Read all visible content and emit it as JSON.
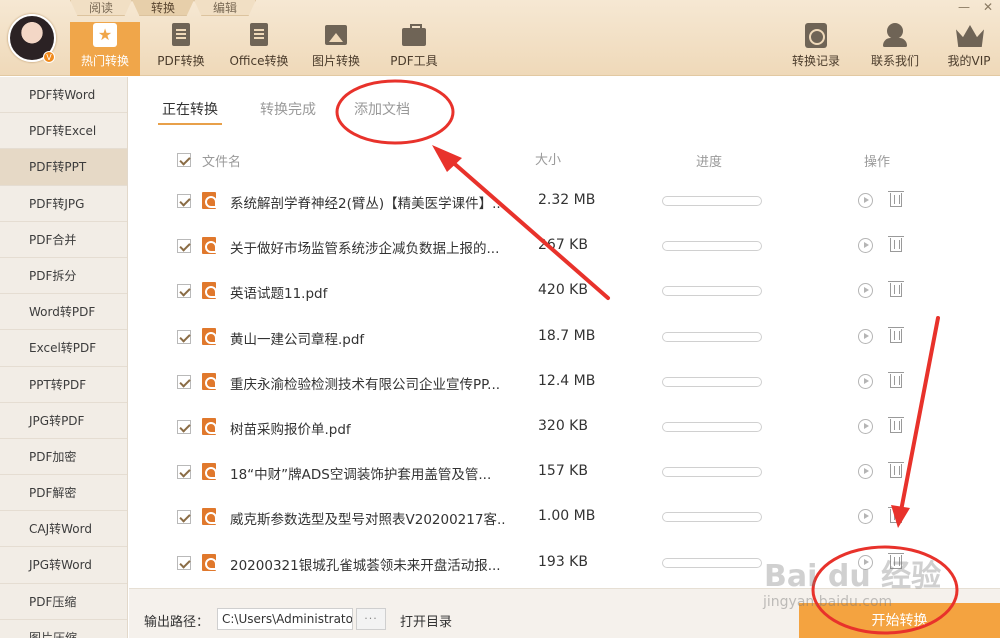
{
  "top_tabs": [
    "阅读",
    "转换",
    "编辑"
  ],
  "top_tab_active": "转换",
  "window_controls": [
    "—",
    "✕"
  ],
  "avatar_badge": "V",
  "nav": [
    {
      "label": "热门转换",
      "icon": "star-icon",
      "active": true
    },
    {
      "label": "PDF转换",
      "icon": "pdf-doc-icon",
      "active": false
    },
    {
      "label": "Office转换",
      "icon": "office-doc-icon",
      "active": false
    },
    {
      "label": "图片转换",
      "icon": "image-icon",
      "active": false
    },
    {
      "label": "PDF工具",
      "icon": "toolbox-icon",
      "active": false
    }
  ],
  "nav_right": [
    {
      "label": "转换记录",
      "icon": "history-clock-icon"
    },
    {
      "label": "联系我们",
      "icon": "support-person-icon"
    },
    {
      "label": "我的VIP",
      "icon": "crown-icon"
    }
  ],
  "sidebar": [
    "PDF转Word",
    "PDF转Excel",
    "PDF转PPT",
    "PDF转JPG",
    "PDF合并",
    "PDF拆分",
    "Word转PDF",
    "Excel转PDF",
    "PPT转PDF",
    "JPG转PDF",
    "PDF加密",
    "PDF解密",
    "CAJ转Word",
    "JPG转Word",
    "PDF压缩",
    "图片压缩"
  ],
  "sidebar_active": "PDF转PPT",
  "tabs": [
    "正在转换",
    "转换完成",
    "添加文档"
  ],
  "tab_active": "正在转换",
  "columns": {
    "filename": "文件名",
    "size": "大小",
    "progress": "进度",
    "action": "操作"
  },
  "files": [
    {
      "name": "系统解剖学脊神经2(臂丛)【精美医学课件】...",
      "size": "2.32 MB",
      "progress": 0
    },
    {
      "name": "关于做好市场监管系统涉企减负数据上报的...",
      "size": "267 KB",
      "progress": 0
    },
    {
      "name": "英语试题11.pdf",
      "size": "420 KB",
      "progress": 0
    },
    {
      "name": "黄山一建公司章程.pdf",
      "size": "18.7 MB",
      "progress": 0
    },
    {
      "name": "重庆永渝检验检测技术有限公司企业宣传PP...",
      "size": "12.4 MB",
      "progress": 0
    },
    {
      "name": "树苗采购报价单.pdf",
      "size": "320 KB",
      "progress": 0
    },
    {
      "name": "18“中财”牌ADS空调装饰护套用盖管及管...",
      "size": "157 KB",
      "progress": 0
    },
    {
      "name": "威克斯参数选型及型号对照表V20200217客...",
      "size": "1.00 MB",
      "progress": 0
    },
    {
      "name": "20200321银城孔雀城荟领未来开盘活动报...",
      "size": "193 KB",
      "progress": 0
    }
  ],
  "footer": {
    "output_label": "输出路径：",
    "output_path": "C:\\Users\\Administrator",
    "browse": "···",
    "open_dir": "打开目录",
    "start": "开始转换"
  },
  "watermark": {
    "main": "Bai du 经验",
    "sub": "jingyan.baidu.com"
  },
  "colors": {
    "accent": "#f0a64a",
    "annotation": "#e8322b",
    "header": "#efd9b9"
  }
}
